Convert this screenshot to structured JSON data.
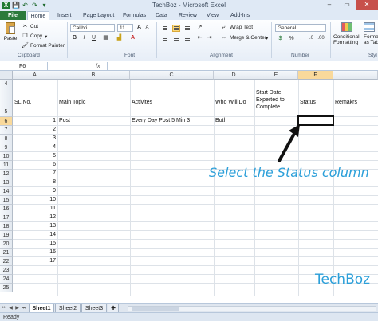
{
  "title_bar": {
    "title": "TechBoz - Microsoft Excel",
    "quick_access": [
      "save-icon",
      "undo-icon",
      "redo-icon",
      "dropdown-icon"
    ],
    "window_buttons": [
      "–",
      "▭",
      "✕"
    ]
  },
  "tabs": [
    "File",
    "Home",
    "Insert",
    "Page Layout",
    "Formulas",
    "Data",
    "Review",
    "View",
    "Add-Ins"
  ],
  "ribbon": {
    "clipboard": {
      "paste": "Paste",
      "cut": "Cut",
      "copy": "Copy",
      "copy_arrow": "▾",
      "format_painter": "Format Painter",
      "label": "Clipboard"
    },
    "font": {
      "name": "Calibri",
      "size": "11",
      "bold": "B",
      "italic": "I",
      "underline": "U",
      "label": "Font"
    },
    "alignment": {
      "wrap_text": "Wrap Text",
      "merge_center": "Merge & Center",
      "merge_arrow": "▾",
      "label": "Alignment"
    },
    "number": {
      "format": "General",
      "currency": "$",
      "percent": "%",
      "comma": ",",
      "label": "Number"
    },
    "styles": {
      "conditional_1": "Conditional",
      "conditional_2": "Formatting",
      "format_as_1": "Forma",
      "format_as_2": "as Tab",
      "label": "Styl"
    }
  },
  "formula_bar": {
    "name_box": "F6",
    "fx": "fx",
    "value": ""
  },
  "columns": [
    "A",
    "B",
    "C",
    "D",
    "E",
    "F"
  ],
  "selected_column": "F",
  "rows": [
    "4",
    "5",
    "6",
    "7",
    "8",
    "9",
    "10",
    "11",
    "12",
    "13",
    "14",
    "15",
    "16",
    "17",
    "18",
    "19",
    "20",
    "21",
    "22",
    "23",
    "24",
    "25"
  ],
  "selected_row": "6",
  "headers": {
    "sl_no": "SL.No.",
    "main_topic": "Main Topic",
    "activities": "Activites",
    "who": "Who  Will Do",
    "start_date": "Start Date Experted to Complete",
    "status": "Status",
    "remarks": "Remakrs"
  },
  "row6": {
    "sl_no": "1",
    "main_topic": "Post",
    "activity": "Every Day Post  5 Min 3",
    "who": "Both"
  },
  "serial_numbers": [
    "2",
    "3",
    "4",
    "5",
    "6",
    "7",
    "8",
    "9",
    "10",
    "11",
    "12",
    "13",
    "14",
    "15",
    "16",
    "17"
  ],
  "annotation": "Select the Status column",
  "watermark": "TechBoz",
  "sheets": [
    "Sheet1",
    "Sheet2",
    "Sheet3"
  ],
  "active_sheet": "Sheet1",
  "status": "Ready"
}
